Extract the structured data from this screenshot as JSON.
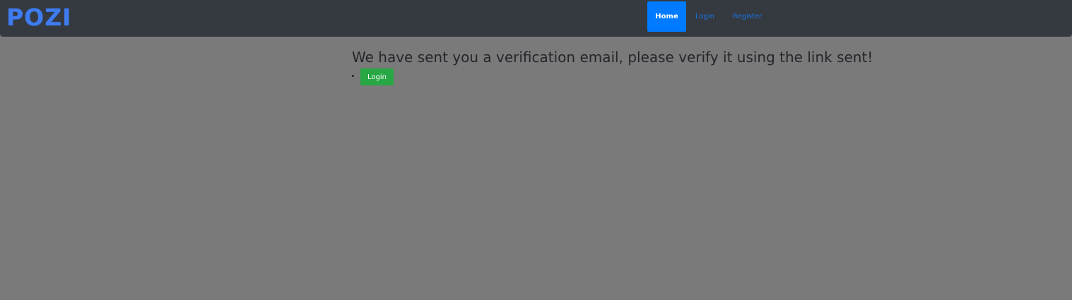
{
  "navbar": {
    "brand": "POZI",
    "items": [
      {
        "label": "Home",
        "active": true
      },
      {
        "label": "Login",
        "active": false
      },
      {
        "label": "Register",
        "active": false
      }
    ]
  },
  "main": {
    "message": "We have sent you a verification email, please verify it using the link sent!",
    "login_button_label": "Login"
  },
  "colors": {
    "page_background": "#7a7a7a",
    "navbar_background": "#343a40",
    "brand": "#3f7cf0",
    "nav_active_background": "#007bff",
    "nav_link": "#1a73e8",
    "login_button": "#28a745"
  }
}
